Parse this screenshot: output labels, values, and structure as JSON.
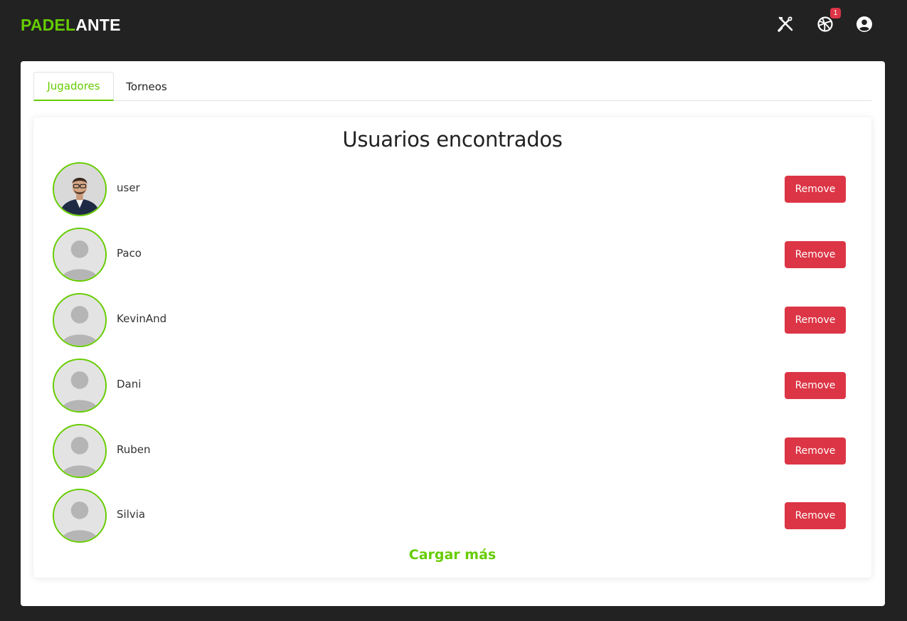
{
  "app": {
    "logo_part1": "PADEL",
    "logo_part2": "ANTE",
    "brand_color": "#66cc00",
    "danger_color": "#dc3545"
  },
  "header": {
    "icons": [
      "tools-icon",
      "basketball-icon",
      "user-circle-icon"
    ],
    "notification_count": "1"
  },
  "tabs": [
    {
      "label": "Jugadores",
      "active": true
    },
    {
      "label": "Torneos",
      "active": false
    }
  ],
  "results": {
    "title": "Usuarios encontrados",
    "users": [
      {
        "name": "user",
        "avatar": "photo",
        "action": "Remove"
      },
      {
        "name": "Paco",
        "avatar": "placeholder",
        "action": "Remove"
      },
      {
        "name": "KevinAnd",
        "avatar": "placeholder",
        "action": "Remove"
      },
      {
        "name": "Dani",
        "avatar": "placeholder",
        "action": "Remove"
      },
      {
        "name": "Ruben",
        "avatar": "placeholder",
        "action": "Remove"
      },
      {
        "name": "Silvia",
        "avatar": "placeholder",
        "action": "Remove"
      }
    ],
    "load_more_label": "Cargar más"
  }
}
